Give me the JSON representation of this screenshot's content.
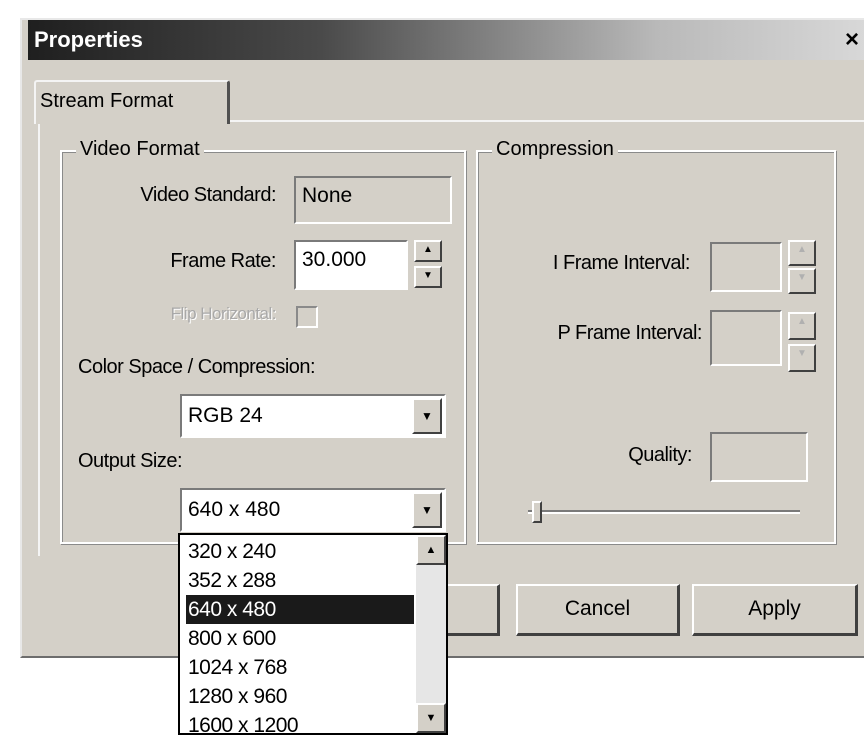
{
  "window": {
    "title": "Properties",
    "close_label": "×"
  },
  "tabs": [
    {
      "label": "Stream Format",
      "selected": true
    }
  ],
  "video_format": {
    "group_label": "Video Format",
    "video_standard_label": "Video Standard:",
    "video_standard_value": "None",
    "frame_rate_label": "Frame Rate:",
    "frame_rate_value": "30.000",
    "flip_label": "Flip Horizontal:",
    "flip_checked": false,
    "color_space_label": "Color Space / Compression:",
    "color_space_value": "RGB 24",
    "output_size_label": "Output Size:",
    "output_size_value": "640 x 480"
  },
  "compression": {
    "group_label": "Compression",
    "i_frame_label": "I Frame Interval:",
    "i_frame_value": "",
    "p_frame_label": "P Frame Interval:",
    "p_frame_value": "",
    "quality_label": "Quality:",
    "quality_value": "",
    "quality_slider": 0
  },
  "output_size_options": [
    "320 x 240",
    "352 x 288",
    "640 x 480",
    "800 x 600",
    "1024 x 768",
    "1280 x 960",
    "1600 x 1200"
  ],
  "output_size_selected_index": 2,
  "buttons": {
    "cancel": "Cancel",
    "apply": "Apply"
  },
  "icons": {
    "spin_up": "▲",
    "spin_down": "▼",
    "dropdown": "▼"
  }
}
